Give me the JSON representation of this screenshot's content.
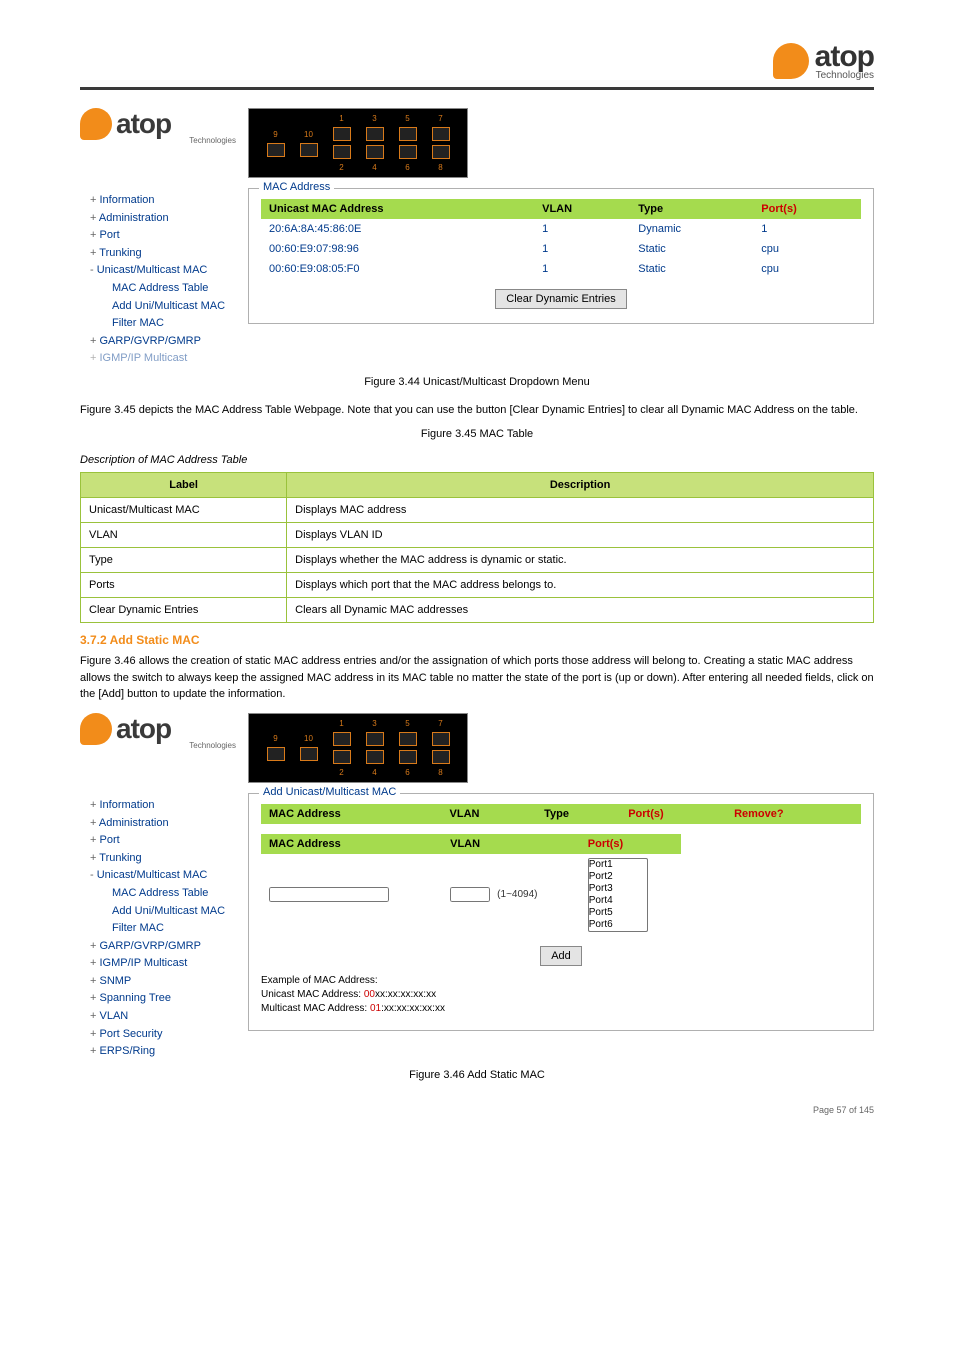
{
  "brand": {
    "name": "atop",
    "sub": "Technologies"
  },
  "fig1": {
    "caption": "Figure 3.44 Unicast/Multicast Dropdown Menu",
    "intro": "Figure 3.45 depicts the MAC Address Table Webpage. Note that you can use the button [Clear Dynamic Entries] to clear all Dynamic MAC Address on the table."
  },
  "nav1": {
    "items": [
      "Information",
      "Administration",
      "Port",
      "Trunking",
      "Unicast/Multicast MAC"
    ],
    "sub": [
      "MAC Address Table",
      "Add Uni/Multicast MAC",
      "Filter MAC"
    ],
    "after": [
      "GARP/GVRP/GMRP",
      "IGMP/IP Multicast"
    ]
  },
  "macPanel": {
    "title": "MAC Address",
    "headers": [
      "Unicast MAC Address",
      "VLAN",
      "Type",
      "Port(s)"
    ],
    "rows": [
      {
        "addr": "20:6A:8A:45:86:0E",
        "vlan": "1",
        "type": "Dynamic",
        "ports": "1"
      },
      {
        "addr": "00:60:E9:07:98:96",
        "vlan": "1",
        "type": "Static",
        "ports": "cpu"
      },
      {
        "addr": "00:60:E9:08:05:F0",
        "vlan": "1",
        "type": "Static",
        "ports": "cpu"
      }
    ],
    "btn": "Clear Dynamic Entries"
  },
  "fig2": {
    "caption": "Figure 3.45 MAC Table",
    "descHeading": "Description of MAC Address Table",
    "tableHead": [
      "Label",
      "Description"
    ],
    "rows": [
      {
        "label": "Unicast/Multicast MAC",
        "desc": "Displays MAC address"
      },
      {
        "label": "VLAN",
        "desc": "Displays VLAN ID"
      },
      {
        "label": "Type",
        "desc": "Displays whether the MAC address is dynamic or static."
      },
      {
        "label": "Ports",
        "desc": "Displays which port that the MAC address belongs to."
      },
      {
        "label": "Clear Dynamic Entries",
        "desc": "Clears all Dynamic MAC addresses"
      }
    ]
  },
  "addSection": {
    "heading": "3.7.2 Add Static MAC",
    "intro": "Figure 3.46 allows the creation of static MAC address entries and/or the assignation of which ports those address will belong to. Creating a static MAC address allows the switch to always keep the assigned MAC address in its MAC table no matter the state of the port is (up or down). After entering all needed fields, click on the [Add] button to update the information.",
    "caption": "Figure 3.46 Add Static MAC"
  },
  "nav2": {
    "items": [
      "Information",
      "Administration",
      "Port",
      "Trunking",
      "Unicast/Multicast MAC"
    ],
    "sub": [
      "MAC Address Table",
      "Add Uni/Multicast MAC",
      "Filter MAC"
    ],
    "after": [
      "GARP/GVRP/GMRP",
      "IGMP/IP Multicast",
      "SNMP",
      "Spanning Tree",
      "VLAN",
      "Port Security",
      "ERPS/Ring"
    ]
  },
  "addPanel": {
    "title": "Add Unicast/Multicast MAC",
    "headers1": [
      "MAC Address",
      "VLAN",
      "Type",
      "Port(s)",
      "Remove?"
    ],
    "headers2": [
      "MAC Address",
      "VLAN",
      "Port(s)"
    ],
    "vlanHint": "(1~4094)",
    "ports": [
      "Port1",
      "Port2",
      "Port3",
      "Port4",
      "Port5",
      "Port6"
    ],
    "btn": "Add",
    "exampleTitle": "Example of MAC Address:",
    "uniLabel": "Unicast MAC Address:",
    "uniVal": "00",
    "uniRest": "xx:xx:xx:xx:xx",
    "multiLabel": "Multicast MAC Address:",
    "multiVal": "01",
    "multiRest": ":xx:xx:xx:xx:xx"
  },
  "footer": {
    "left": "",
    "right": "Page 57 of 145"
  }
}
